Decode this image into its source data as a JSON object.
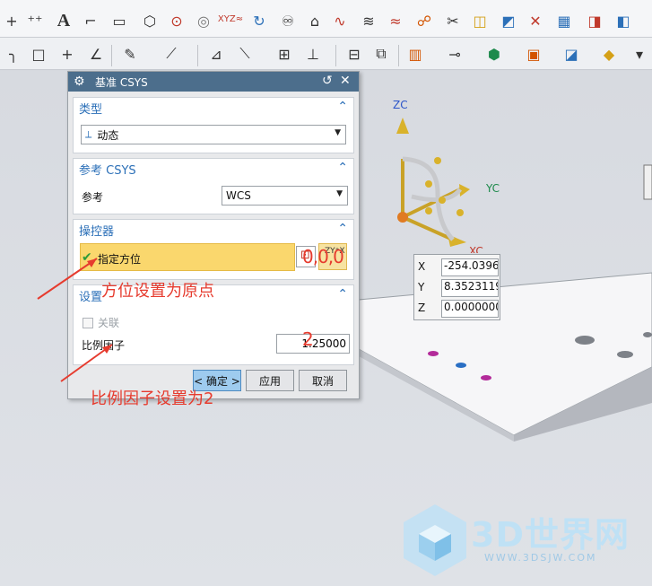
{
  "dialog": {
    "title": "基准 CSYS",
    "type_group": {
      "header": "类型",
      "value": "动态"
    },
    "ref_group": {
      "header": "参考 CSYS",
      "label": "参考",
      "value": "WCS"
    },
    "manip_group": {
      "header": "操控器",
      "label": "指定方位"
    },
    "settings_group": {
      "header": "设置",
      "link_label": "关联",
      "scale_label": "比例因子",
      "scale_value": "1.25000"
    },
    "ok_label": "< 确定 >",
    "apply_label": "应用",
    "cancel_label": "取消"
  },
  "csys": {
    "zc": "ZC",
    "yc": "YC",
    "xc": "XC"
  },
  "coords": {
    "x_label": "X",
    "x_value": "-254.0396",
    "y_label": "Y",
    "y_value": "8.3523119",
    "z_label": "Z",
    "z_value": "0.0000000"
  },
  "annotations": {
    "orient_note": "方位设置为原点",
    "scale_note": "比例因子设置为2",
    "scale_2": "2",
    "origin_text": "0,0,0"
  },
  "watermark": {
    "brand": "3D世界网",
    "url": "WWW.3DSJW.COM"
  },
  "colors": {
    "title_bar": "#4c6e8c",
    "accent": "#2c70b8",
    "highlight": "#fad76d",
    "annotation": "#e63b2e"
  }
}
